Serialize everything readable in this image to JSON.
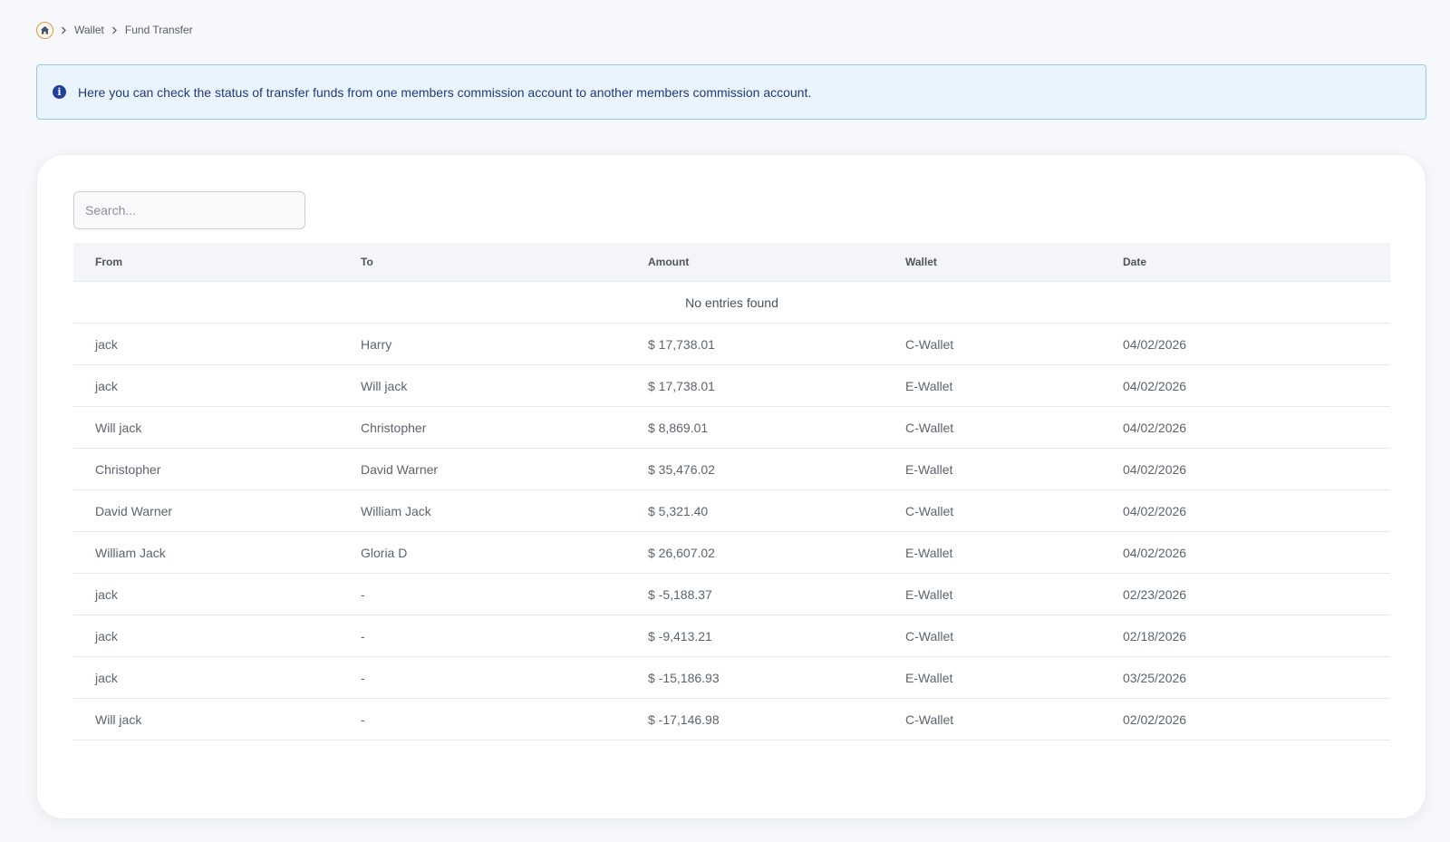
{
  "breadcrumb": {
    "home_icon": "home-icon",
    "items": [
      "Wallet",
      "Fund Transfer"
    ]
  },
  "info_alert": {
    "icon": "info-icon",
    "icon_glyph": "i",
    "text": "Here you can check the status of transfer funds from one members commission account to another members commission account."
  },
  "search": {
    "placeholder": "Search...",
    "value": ""
  },
  "table": {
    "columns": [
      "From",
      "To",
      "Amount",
      "Wallet",
      "Date"
    ],
    "empty_message": "No entries found",
    "rows": [
      [
        "jack",
        "Harry",
        "$ 17,738.01",
        "C-Wallet",
        "04/02/2026"
      ],
      [
        "jack",
        "Will jack",
        "$ 17,738.01",
        "E-Wallet",
        "04/02/2026"
      ],
      [
        "Will jack",
        "Christopher",
        "$ 8,869.01",
        "C-Wallet",
        "04/02/2026"
      ],
      [
        "Christopher",
        "David Warner",
        "$ 35,476.02",
        "E-Wallet",
        "04/02/2026"
      ],
      [
        "David Warner",
        "William Jack",
        "$ 5,321.40",
        "C-Wallet",
        "04/02/2026"
      ],
      [
        "William Jack",
        "Gloria D",
        "$ 26,607.02",
        "E-Wallet",
        "04/02/2026"
      ],
      [
        "jack",
        "-",
        "$ -5,188.37",
        "E-Wallet",
        "02/23/2026"
      ],
      [
        "jack",
        "-",
        "$ -9,413.21",
        "C-Wallet",
        "02/18/2026"
      ],
      [
        "jack",
        "-",
        "$ -15,186.93",
        "E-Wallet",
        "03/25/2026"
      ],
      [
        "Will jack",
        "-",
        "$ -17,146.98",
        "C-Wallet",
        "02/02/2026"
      ]
    ]
  },
  "colors": {
    "accent_home": "#d99a3e",
    "alert_bg": "#eaf4fe",
    "alert_border": "#9cc6ec",
    "alert_text": "#1e3a7a"
  }
}
